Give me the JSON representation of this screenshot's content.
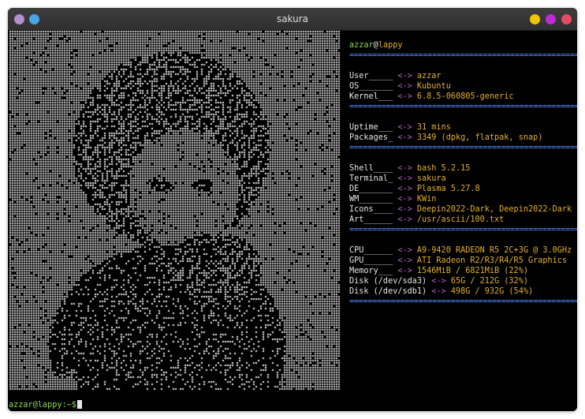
{
  "window": {
    "title": "sakura",
    "left_buttons": [
      {
        "name": "menu-icon",
        "color": "#b58fd0"
      },
      {
        "name": "pin-icon",
        "color": "#47a6e6"
      }
    ],
    "right_buttons": [
      {
        "name": "minimize-icon",
        "color": "#f2c500"
      },
      {
        "name": "maximize-icon",
        "color": "#c12ad8"
      },
      {
        "name": "close-icon",
        "color": "#e84a5f"
      }
    ]
  },
  "fetch": {
    "user": "azzar",
    "at": "@",
    "host": "lappy",
    "separator": "==================================================",
    "sections": [
      [
        {
          "key": "User_____",
          "arrow": "<->",
          "value": "azzar"
        },
        {
          "key": "OS_______",
          "arrow": "<->",
          "value": "Kubuntu"
        },
        {
          "key": "Kernel___",
          "arrow": "<->",
          "value": "6.8.5-060805-generic"
        }
      ],
      [
        {
          "key": "Uptime___",
          "arrow": "<->",
          "value": "31 mins"
        },
        {
          "key": "Packages_",
          "arrow": "<->",
          "value": "3349 (dpkg, flatpak, snap)"
        }
      ],
      [
        {
          "key": "Shell____",
          "arrow": "<->",
          "value": "bash 5.2.15"
        },
        {
          "key": "Terminal_",
          "arrow": "<->",
          "value": "sakura"
        },
        {
          "key": "DE_______",
          "arrow": "<->",
          "value": "Plasma 5.27.8"
        },
        {
          "key": "WM_______",
          "arrow": "<->",
          "value": "KWin"
        },
        {
          "key": "Icons____",
          "arrow": "<->",
          "value": "Deepin2022-Dark, Deepin2022-Dark"
        },
        {
          "key": "Art______",
          "arrow": "<->",
          "value": "/usr/ascii/100.txt"
        }
      ],
      [
        {
          "key": "CPU______",
          "arrow": "<->",
          "value": "A9-9420 RADEON R5 2C+3G @ 3.0GHz"
        },
        {
          "key": "GPU______",
          "arrow": "<->",
          "value": "ATI Radeon R2/R3/R4/R5 Graphics"
        },
        {
          "key": "Memory___",
          "arrow": "<->",
          "value": "1546MiB / 6821MiB (22%)"
        },
        {
          "key": "Disk (/dev/sda3)",
          "arrow": "<->",
          "value": "65G / 212G (32%)"
        },
        {
          "key": "Disk (/dev/sdb1)",
          "arrow": "<->",
          "value": "498G / 932G (54%)"
        }
      ]
    ]
  },
  "prompt": {
    "text": "azzar@lappy:~$"
  }
}
